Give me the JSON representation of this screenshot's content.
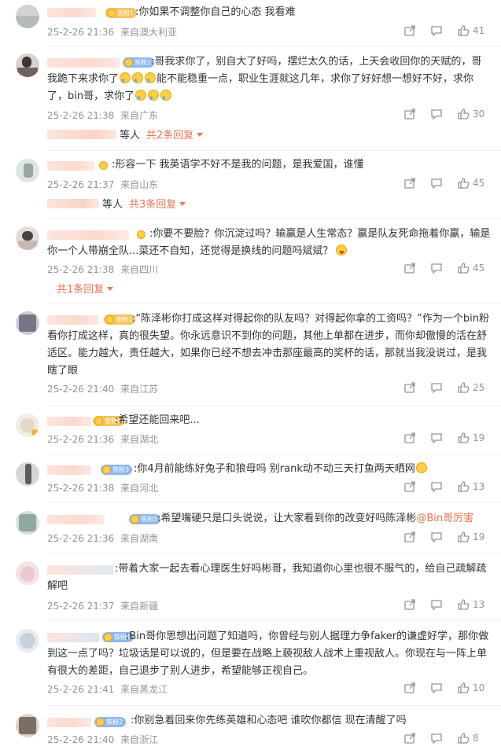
{
  "comments": [
    {
      "badge": "金粉1",
      "badge_type": "gold",
      "text": ":你如果不调整你自己的心态 我看难",
      "time": "25-2-26 21:36",
      "location": "来自澳大利亚",
      "likes": "41"
    },
    {
      "badge": "铁粉2",
      "badge_type": "fan",
      "text_parts": [
        ":哥我求你了，别自大了好吗，摆烂太久的话，上天会收回你的天赋的，哥我跪下来求你了",
        "能不能稳重一点，职业生涯就这几年，求你了好好想一想好不好，求你了，bin哥，求你了"
      ],
      "time": "25-2-26 21:38",
      "location": "来自广东",
      "likes": "30",
      "replies": {
        "who": "等人",
        "more": "共2条回复"
      }
    },
    {
      "badge": "",
      "badge_type": "none",
      "text": ":形容一下 我英语学不好不是我的问题，是我爱国，谁懂",
      "time": "25-2-26 21:37",
      "location": "来自山东",
      "likes": "45",
      "replies": {
        "who": "等人",
        "more": "共3条回复"
      }
    },
    {
      "badge": "",
      "badge_type": "none",
      "text": ":你要不要脸？你沉淀过吗？输赢是人生常态？赢是队友死命拖着你赢，输是你一个人带崩全队...菜还不自知，还觉得是换线的问题吗斌斌？",
      "time": "25-2-26 21:38",
      "location": "来自四川",
      "likes": "45",
      "replies": {
        "who": "",
        "more": "共1条回复"
      }
    },
    {
      "badge": "金粉1",
      "badge_type": "gold",
      "text": ":“陈泽彬你打成这样对得起你的队友吗？对得起你拿的工资吗？”作为一个bin粉看你打成这样，真的很失望。你永远意识不到你的问题，其他上单都在进步，而你却傲慢的活在舒适区。能力越大，责任越大，如果你已经不想去冲击那座最高的奖杯的话，那就当我没说过，是我瞎了眼",
      "time": "25-2-26 21:40",
      "location": "来自江苏",
      "likes": "25"
    },
    {
      "badge": "金粉4",
      "badge_type": "gold",
      "text": ":希望还能回来吧...",
      "time": "25-2-26 21:36",
      "location": "来自湖北",
      "likes": "19"
    },
    {
      "badge": "铁粉3",
      "badge_type": "fan",
      "text": ":你4月前能练好兔子和狼母吗 别rank动不动三天打鱼两天晒网",
      "time": "25-2-26 21:38",
      "location": "来自河北",
      "likes": "13"
    },
    {
      "badge": "铁粉5",
      "badge_type": "fan",
      "text": ":希望嘴硬只是口头说说，让大家看到你的改变好吗陈泽彬",
      "mention": "@Bin哥厉害",
      "time": "25-2-26 21:36",
      "location": "来自湖南",
      "likes": "19"
    },
    {
      "badge": "",
      "badge_type": "none",
      "text": ":带着大家一起去看心理医生好吗彬哥，我知道你心里也很不服气的，给自己疏解疏解吧",
      "time": "25-2-26 21:37",
      "location": "来自新疆",
      "likes": "13"
    },
    {
      "badge": "铁粉1",
      "badge_type": "fan",
      "text": ":Bin哥你思想出问题了知道吗，你曾经与别人据理力争faker的谦虚好学，那你做到这一点了吗？垃圾话是可以说的，但是要在战略上藐视敌人战术上重视敌人。你现在与一阵上单有很大的差距，自己退步了别人进步，希望能够正视自己。",
      "time": "25-2-26 21:41",
      "location": "来自黑龙江",
      "likes": "10"
    },
    {
      "badge": "铁粉2",
      "badge_type": "fan",
      "text": ":你别急着回来你先练英雄和心态吧 谁吹你都信 现在清醒了吗",
      "time": "25-2-26 21:40",
      "location": "来自浙江",
      "likes": "8"
    }
  ],
  "icons": {
    "share": "share-icon",
    "comment": "comment-icon",
    "like": "thumbs-up-icon"
  },
  "colors": {
    "accent": "#eb7350",
    "meta": "#939393",
    "text": "#333333",
    "gold_badge": "#f6c35c",
    "fan_badge": "#8fb8ee"
  }
}
